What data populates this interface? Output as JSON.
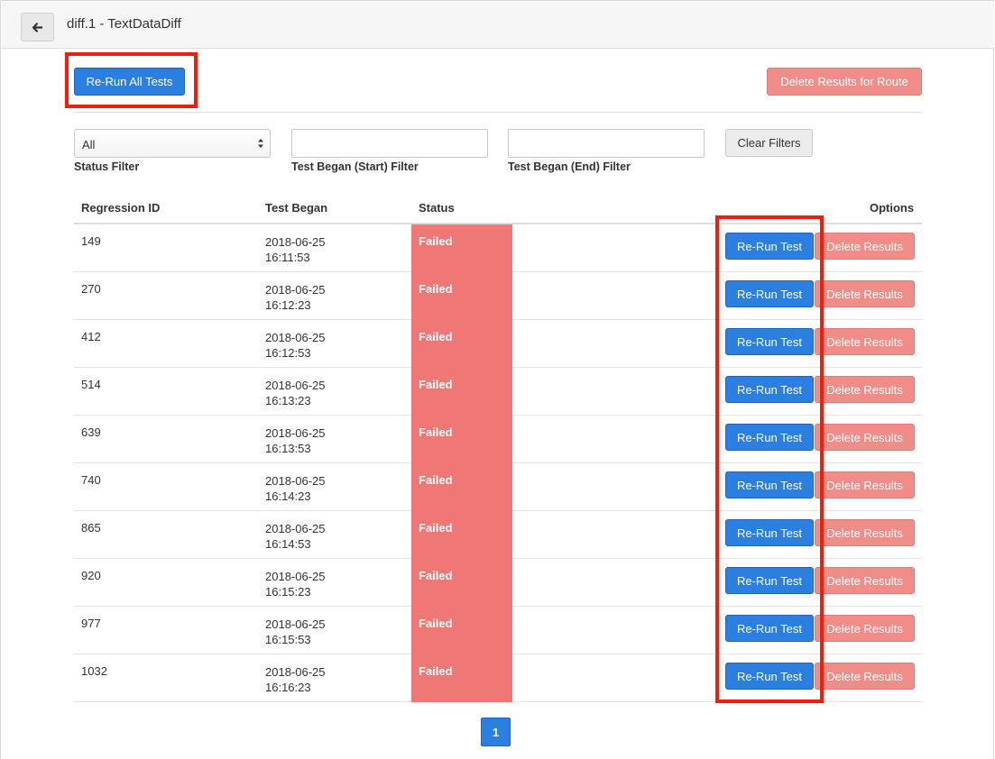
{
  "header": {
    "title": "diff.1 - TextDataDiff",
    "back_icon": "arrow-left-icon"
  },
  "toolbar": {
    "rerun_all_label": "Re-Run All Tests",
    "delete_route_label": "Delete Results for Route"
  },
  "filters": {
    "status_value": "All",
    "status_label": "Status Filter",
    "start_label": "Test Began (Start) Filter",
    "start_value": "",
    "end_label": "Test Began (End) Filter",
    "end_value": "",
    "clear_label": "Clear Filters"
  },
  "table": {
    "columns": [
      "Regression ID",
      "Test Began",
      "Status",
      "Options"
    ],
    "rerun_label": "Re-Run Test",
    "delete_label": "Delete Results",
    "rows": [
      {
        "id": "149",
        "date": "2018-06-25",
        "time": "16:11:53",
        "status": "Failed"
      },
      {
        "id": "270",
        "date": "2018-06-25",
        "time": "16:12:23",
        "status": "Failed"
      },
      {
        "id": "412",
        "date": "2018-06-25",
        "time": "16:12:53",
        "status": "Failed"
      },
      {
        "id": "514",
        "date": "2018-06-25",
        "time": "16:13:23",
        "status": "Failed"
      },
      {
        "id": "639",
        "date": "2018-06-25",
        "time": "16:13:53",
        "status": "Failed"
      },
      {
        "id": "740",
        "date": "2018-06-25",
        "time": "16:14:23",
        "status": "Failed"
      },
      {
        "id": "865",
        "date": "2018-06-25",
        "time": "16:14:53",
        "status": "Failed"
      },
      {
        "id": "920",
        "date": "2018-06-25",
        "time": "16:15:23",
        "status": "Failed"
      },
      {
        "id": "977",
        "date": "2018-06-25",
        "time": "16:15:53",
        "status": "Failed"
      },
      {
        "id": "1032",
        "date": "2018-06-25",
        "time": "16:16:23",
        "status": "Failed"
      }
    ]
  },
  "pagination": {
    "current_page": "1"
  },
  "colors": {
    "primary": "#2a7fe0",
    "danger_light": "#f08d88",
    "status_failed": "#ef7775",
    "highlight": "#f01e0a"
  }
}
